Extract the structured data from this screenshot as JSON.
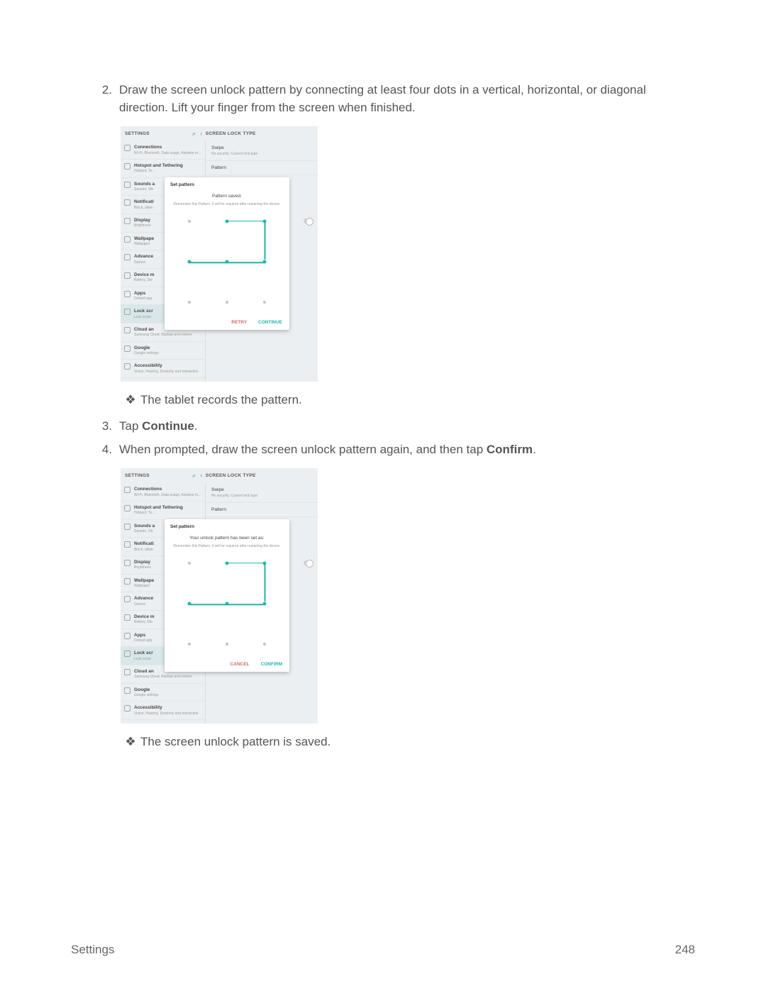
{
  "steps": {
    "s2": "Draw the screen unlock pattern by connecting at least four dots in a vertical, horizontal, or diagonal direction. Lift your finger from the screen when finished.",
    "s3_pre": "Tap ",
    "s3_b": "Continue",
    "s3_post": ".",
    "s4_pre": "When prompted, draw the screen unlock pattern again, and then tap ",
    "s4_b": "Confirm",
    "s4_post": "."
  },
  "bullets": {
    "b1": "The tablet records the pattern.",
    "b2": "The screen unlock pattern is saved."
  },
  "footer": {
    "left": "Settings",
    "right": "248"
  },
  "shot": {
    "settings_label": "SETTINGS",
    "right_label": "SCREEN LOCK TYPE",
    "left_items": [
      {
        "t": "Connections",
        "s": "Wi-Fi, Bluetooth, Data usage, Airplane m..."
      },
      {
        "t": "Hotspot and Tethering",
        "s": "Hotspot, Te..."
      },
      {
        "t": "Sounds a",
        "s": "Sounds, Vib"
      },
      {
        "t": "Notificati",
        "s": "Block, allow"
      },
      {
        "t": "Display",
        "s": "Brightness"
      },
      {
        "t": "Wallpape",
        "s": "Wallpaper"
      },
      {
        "t": "Advance",
        "s": "Games"
      },
      {
        "t": "Device m",
        "s": "Battery, Sto"
      },
      {
        "t": "Apps",
        "s": "Default app"
      },
      {
        "t": "Lock scr",
        "s": "Lock scree",
        "sel": true
      },
      {
        "t": "Cloud an",
        "s": "Samsung Cloud, Backup and restore"
      },
      {
        "t": "Google",
        "s": "Google settings"
      },
      {
        "t": "Accessibility",
        "s": "Vision, Hearing, Dexterity and interaction"
      }
    ],
    "right_items": [
      {
        "t": "Swipe",
        "s": "No security. Current lock type"
      },
      {
        "t": "Pattern",
        "s": ""
      }
    ],
    "dialog1": {
      "title": "Set pattern",
      "msg": "Pattern saved.",
      "note": "Remember this Pattern. It will be required after restarting the device.",
      "btn1": "RETRY",
      "btn2": "CONTINUE"
    },
    "dialog2": {
      "title": "Set pattern",
      "msg": "Your unlock pattern has been set as:",
      "note": "Remember this Pattern. It will be required after restarting the device.",
      "btn1": "CANCEL",
      "btn2": "CONFIRM"
    }
  }
}
